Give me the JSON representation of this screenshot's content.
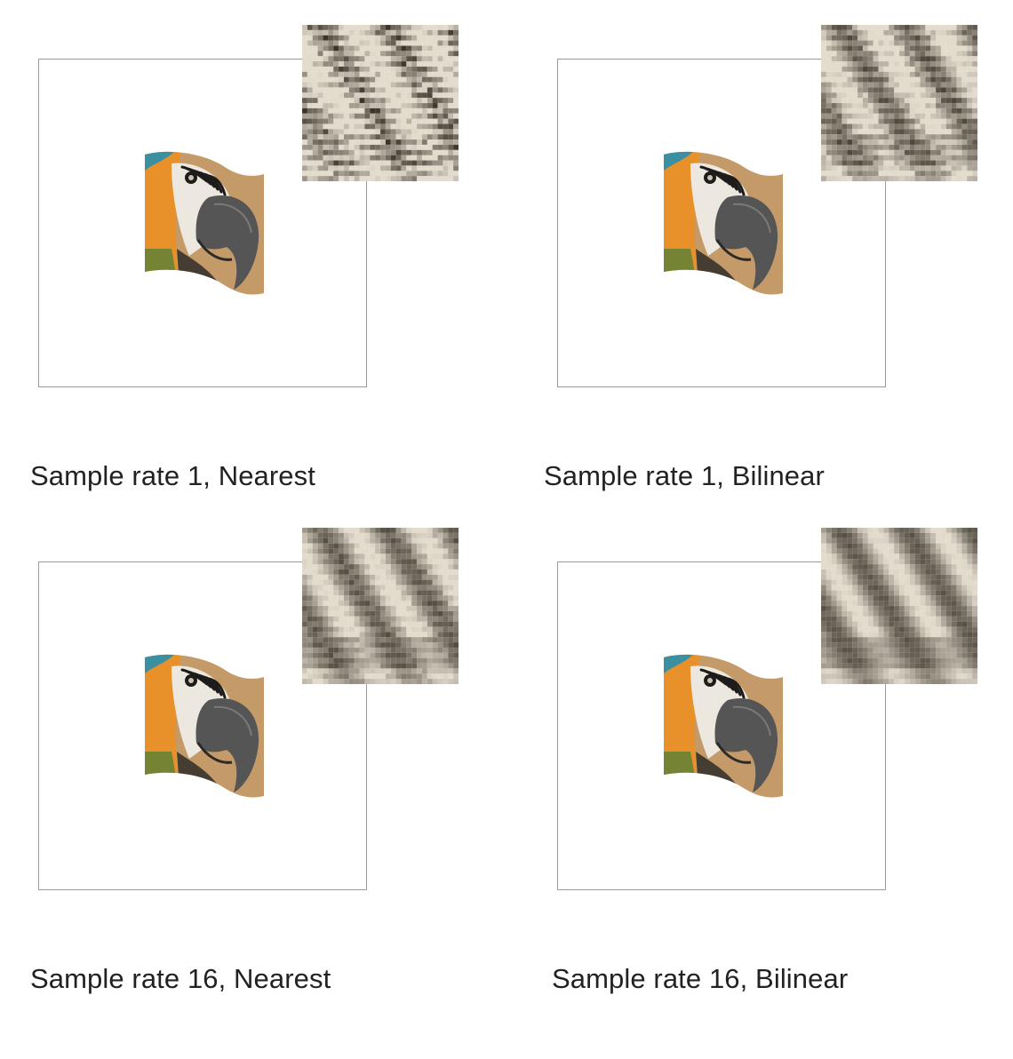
{
  "panels": [
    {
      "caption": "Sample rate 1, Nearest",
      "sample_rate": 1,
      "filter": "Nearest",
      "zoom_inset": {
        "smoothing": 0.0
      }
    },
    {
      "caption": "Sample rate 1, Bilinear",
      "sample_rate": 1,
      "filter": "Bilinear",
      "zoom_inset": {
        "smoothing": 0.5
      }
    },
    {
      "caption": "Sample rate 16, Nearest",
      "sample_rate": 16,
      "filter": "Nearest",
      "zoom_inset": {
        "smoothing": 0.7
      }
    },
    {
      "caption": "Sample rate 16, Bilinear",
      "sample_rate": 16,
      "filter": "Bilinear",
      "zoom_inset": {
        "smoothing": 0.85
      }
    }
  ],
  "image_subject": "macaw-parrot-head",
  "colors": {
    "frame_border": "#9a9a9a",
    "caption_text": "#222222",
    "feather_dark": "#3b342a",
    "feather_light": "#e3dccd",
    "background_tan": "#c49a68",
    "parrot_orange": "#e8902a",
    "parrot_teal": "#3a8fa0",
    "beak_gray": "#555555"
  }
}
